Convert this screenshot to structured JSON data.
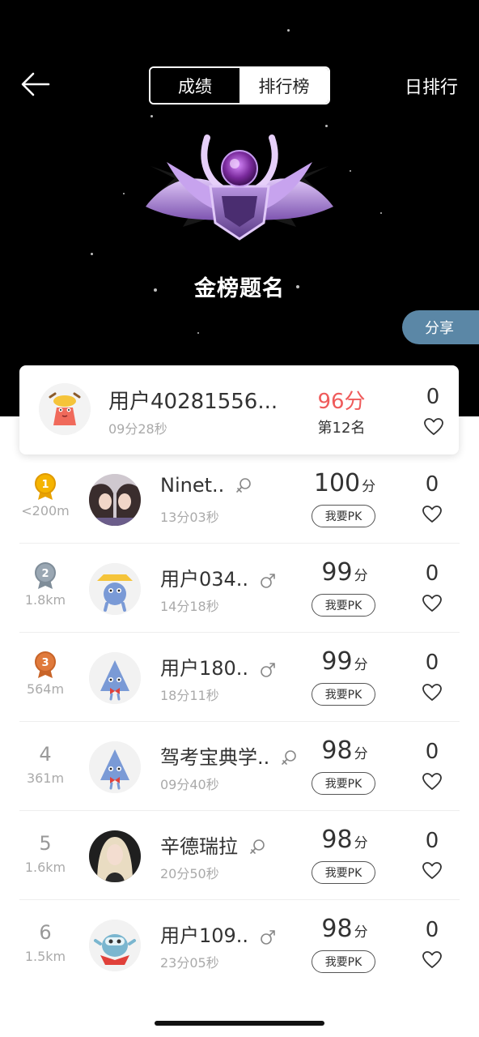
{
  "header": {
    "tabs": [
      {
        "label": "成绩",
        "active": false
      },
      {
        "label": "排行榜",
        "active": true
      }
    ],
    "period_label": "日排行",
    "badge_title": "金榜题名",
    "share_label": "分享"
  },
  "my_entry": {
    "name": "用户40281556...",
    "time": "09分28秒",
    "score": "96分",
    "rank": "第12名",
    "likes": "0"
  },
  "leaderboard": [
    {
      "rank": "1",
      "medal": "gold",
      "distance": "<200m",
      "name": "Ninet..",
      "gender": "female",
      "time": "13分03秒",
      "score": "100",
      "unit": "分",
      "pk_label": "我要PK",
      "likes": "0"
    },
    {
      "rank": "2",
      "medal": "silver",
      "distance": "1.8km",
      "name": "用户034..",
      "gender": "male",
      "time": "14分18秒",
      "score": "99",
      "unit": "分",
      "pk_label": "我要PK",
      "likes": "0"
    },
    {
      "rank": "3",
      "medal": "bronze",
      "distance": "564m",
      "name": "用户180..",
      "gender": "male",
      "time": "18分11秒",
      "score": "99",
      "unit": "分",
      "pk_label": "我要PK",
      "likes": "0"
    },
    {
      "rank": "4",
      "medal": "",
      "distance": "361m",
      "name": "驾考宝典学..",
      "gender": "female",
      "time": "09分40秒",
      "score": "98",
      "unit": "分",
      "pk_label": "我要PK",
      "likes": "0"
    },
    {
      "rank": "5",
      "medal": "",
      "distance": "1.6km",
      "name": "辛德瑞拉",
      "gender": "female",
      "time": "20分50秒",
      "score": "98",
      "unit": "分",
      "pk_label": "我要PK",
      "likes": "0"
    },
    {
      "rank": "6",
      "medal": "",
      "distance": "1.5km",
      "name": "用户109..",
      "gender": "male",
      "time": "23分05秒",
      "score": "98",
      "unit": "分",
      "pk_label": "我要PK",
      "likes": "0"
    }
  ],
  "colors": {
    "highlight_score": "#ef5b5b",
    "share_bg": "#5b87a6",
    "gold": "#f5b400",
    "silver": "#9aa7b3",
    "bronze": "#e07a3c"
  }
}
